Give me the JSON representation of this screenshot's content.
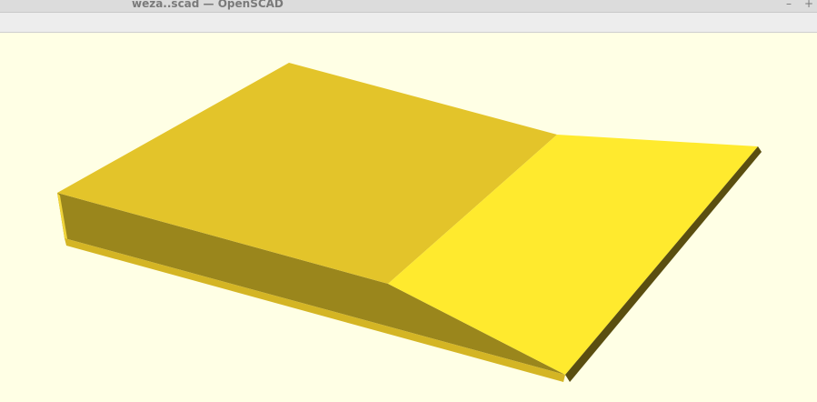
{
  "window": {
    "title": "weza..scad — OpenSCAD",
    "minimize_glyph": "–",
    "maximize_glyph": "+"
  },
  "viewport": {
    "background_color": "#ffffe5",
    "model": {
      "top_face_color": "#e3c42a",
      "slope_face_color": "#ffea2e",
      "front_face_color": "#9a861c",
      "bottom_edge_color": "#d4b524",
      "right_edge_color": "#5a4e10",
      "left_edge_color": "#f0d43a"
    }
  }
}
